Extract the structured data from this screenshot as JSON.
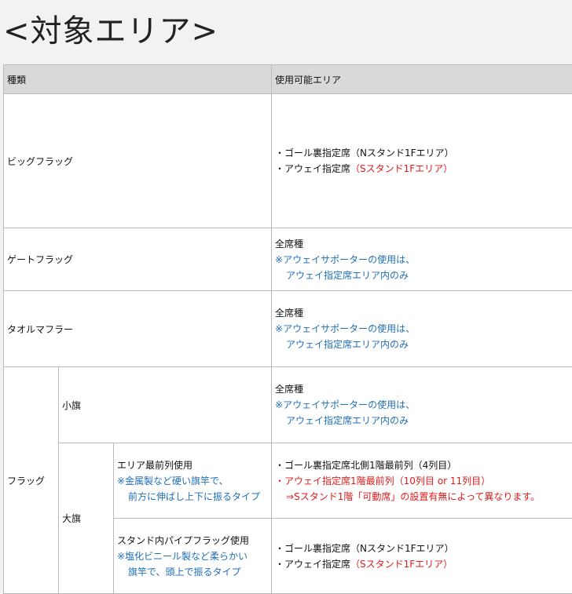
{
  "page": {
    "title": "<対象エリア>"
  },
  "table": {
    "headers": {
      "type": "種類",
      "area": "使用可能エリア"
    },
    "common": {
      "all_seats": "全席種",
      "away_note_1": "※アウェイサポーターの使用は、",
      "away_note_2": "アウェイ指定席エリア内のみ"
    },
    "rows": {
      "big_flag": {
        "label": "ビッグフラッグ",
        "line1": "・ゴール裏指定席（Nスタンド1Fエリア）",
        "line2_prefix": "・アウェイ指定席",
        "line2_red": "（Sスタンド1Fエリア）"
      },
      "gate_flag": {
        "label": "ゲートフラッグ"
      },
      "towel": {
        "label": "タオルマフラー"
      },
      "flag": {
        "label": "フラッグ",
        "small": {
          "label": "小旗"
        },
        "large": {
          "label": "大旗",
          "front": {
            "cond": "エリア最前列使用",
            "note1": "※金属製など硬い旗竿で、",
            "note2": "前方に伸ばし上下に振るタイプ",
            "area1": "・ゴール裏指定席北側1階最前列（4列目）",
            "area2": "・アウェイ指定席1階最前列（10列目 or 11列目）",
            "area3": "⇒Sスタンド1階「可動席」の設置有無によって異なります。"
          },
          "pipe": {
            "cond": "スタンド内パイプフラッグ使用",
            "note1": "※塩化ビニール製など柔らかい",
            "note2": "旗竿で、頭上で振るタイプ",
            "area1": "・ゴール裏指定席（Nスタンド1Fエリア）",
            "area2_prefix": "・アウェイ指定席",
            "area2_red": "（Sスタンド1Fエリア）"
          }
        }
      }
    }
  },
  "colors": {
    "red": "#e01b1b",
    "blue": "#1f6fb8",
    "header_bg": "#d9d9d9",
    "page_bg": "#f2f2f2"
  }
}
